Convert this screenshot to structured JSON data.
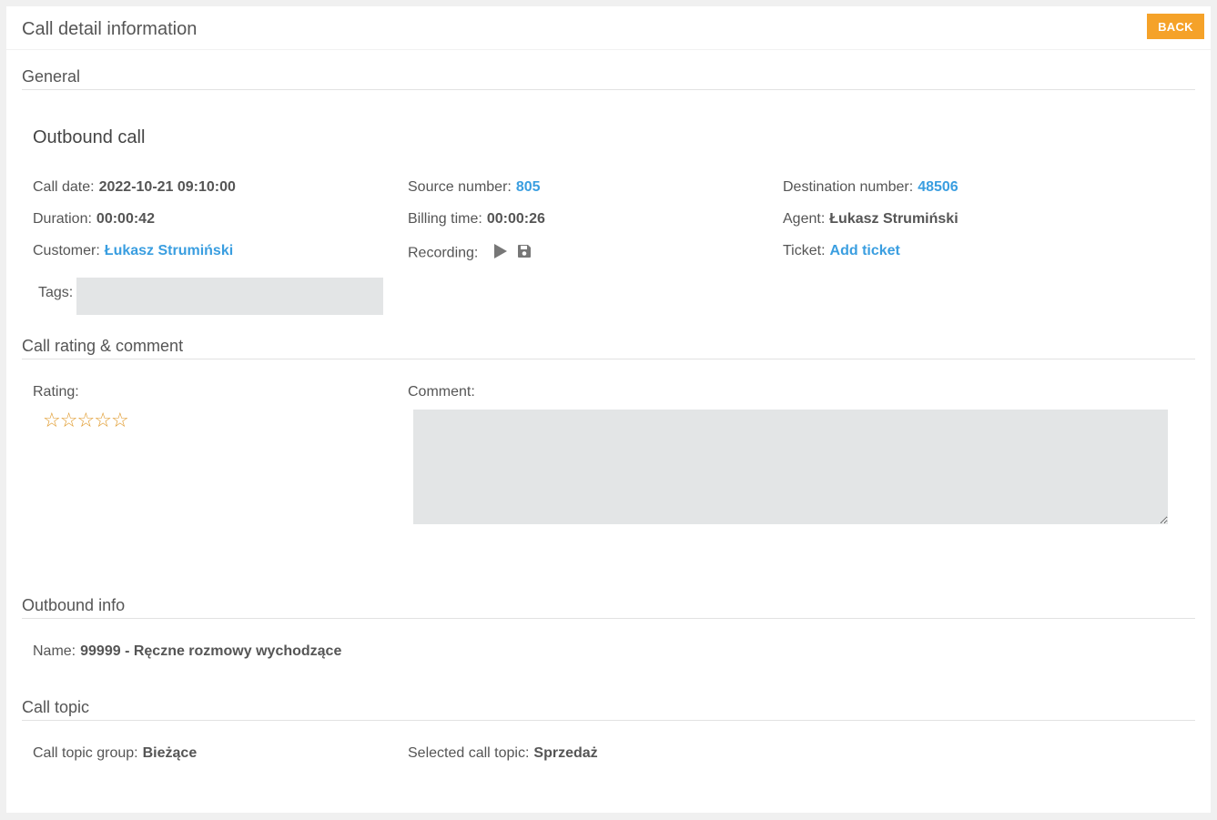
{
  "header": {
    "title": "Call detail information",
    "back_label": "BACK"
  },
  "sections": {
    "general": "General",
    "rating": "Call rating & comment",
    "outbound": "Outbound info",
    "topic": "Call topic"
  },
  "general": {
    "call_type": "Outbound call",
    "call_date_label": "Call date:",
    "call_date": "2022-10-21 09:10:00",
    "duration_label": "Duration:",
    "duration": "00:00:42",
    "customer_label": "Customer:",
    "customer": "Łukasz Strumiński",
    "tags_label": "Tags:",
    "tags_value": "",
    "source_label": "Source number:",
    "source": "805",
    "billing_label": "Billing time:",
    "billing": "00:00:26",
    "recording_label": "Recording:",
    "destination_label": "Destination number:",
    "destination": "48506",
    "agent_label": "Agent:",
    "agent": "Łukasz Strumiński",
    "ticket_label": "Ticket:",
    "ticket_link": "Add ticket"
  },
  "rating": {
    "rating_label": "Rating:",
    "stars_total": 5,
    "stars_selected": 0,
    "star_glyph": "☆",
    "comment_label": "Comment:",
    "comment_value": ""
  },
  "outbound": {
    "name_label": "Name:",
    "name": "99999 - Ręczne rozmowy wychodzące"
  },
  "topic": {
    "group_label": "Call topic group:",
    "group": "Bieżące",
    "selected_label": "Selected call topic:",
    "selected": "Sprzedaż"
  },
  "icons": {
    "play": "play-icon",
    "save": "save-icon",
    "star": "star-icon"
  },
  "colors": {
    "accent": "#f5a229",
    "link": "#3a9ee0",
    "star": "#e09a2c",
    "input_bg": "#e3e5e6"
  }
}
